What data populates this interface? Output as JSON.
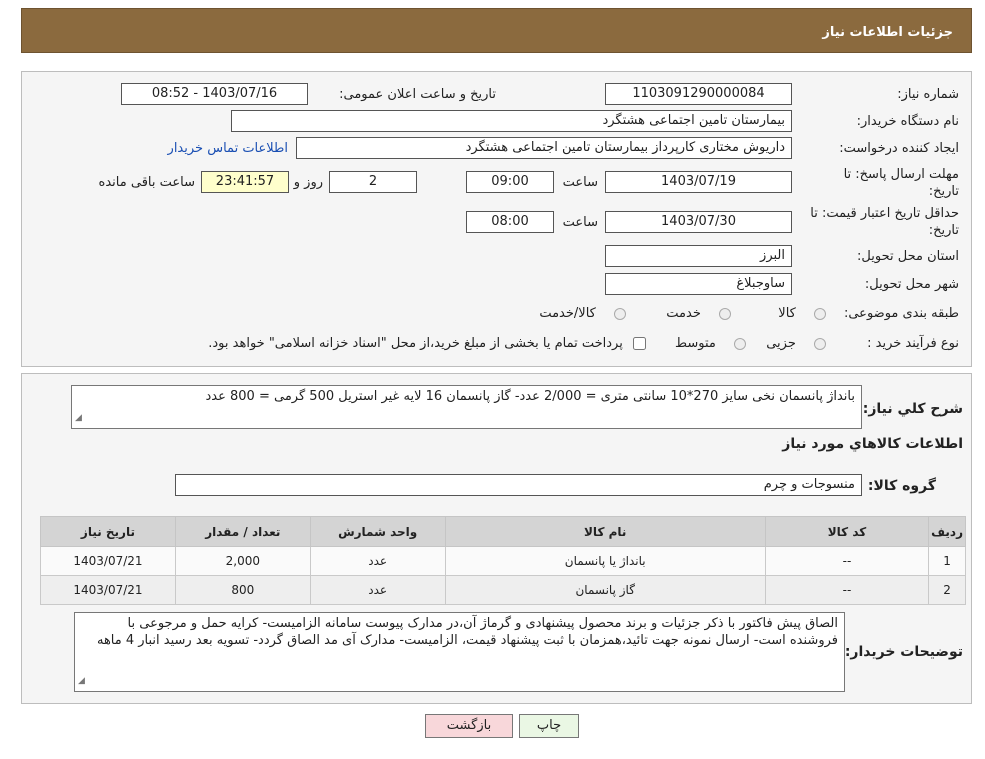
{
  "header": {
    "title": "جزئیات اطلاعات نیاز"
  },
  "form": {
    "need_number_label": "شماره نیاز:",
    "need_number": "1103091290000084",
    "announce_label": "تاریخ و ساعت اعلان عمومی:",
    "announce_value": "1403/07/16 - 08:52",
    "buyer_org_label": "نام دستگاه خریدار:",
    "buyer_org": "بیمارستان تامین اجتماعی هشتگرد",
    "creator_label": "ایجاد کننده درخواست:",
    "creator": "داریوش مختاری کارپرداز بیمارستان تامین اجتماعی هشتگرد",
    "contact_link": "اطلاعات تماس خریدار",
    "reply_deadline_label": "مهلت ارسال پاسخ: تا تاریخ:",
    "reply_date": "1403/07/19",
    "time_label": "ساعت",
    "reply_time": "09:00",
    "days": "2",
    "days_label": "روز و",
    "remaining": "23:41:57",
    "remaining_label": "ساعت باقی مانده",
    "price_validity_label": "حداقل تاریخ اعتبار قیمت: تا تاریخ:",
    "price_date": "1403/07/30",
    "price_time": "08:00",
    "province_label": "استان محل تحویل:",
    "province": "البرز",
    "city_label": "شهر محل تحویل:",
    "city": "ساوجبلاغ",
    "category_label": "طبقه بندی موضوعی:",
    "category_options": [
      "کالا",
      "خدمت",
      "کالا/خدمت"
    ],
    "process_label": "نوع فرآیند خرید :",
    "process_options": [
      "جزیی",
      "متوسط"
    ],
    "process_note": "پرداخت تمام یا بخشی از مبلغ خرید،از محل \"اسناد خزانه اسلامی\" خواهد بود."
  },
  "details": {
    "summary_label": "شرح کلي نياز:",
    "summary": "بانداژ پانسمان نخی سایز 270*10 سانتی متری = 2/000 عدد- گاز پانسمان 16 لایه غیر استریل 500 گرمی = 800 عدد",
    "goods_info_title": "اطلاعات کالاهاي مورد نياز",
    "goods_group_label": "گروه کالا:",
    "goods_group": "منسوجات و چرم",
    "table": {
      "headers": [
        "ردیف",
        "کد کالا",
        "نام کالا",
        "واحد شمارش",
        "تعداد / مقدار",
        "تاریخ نیاز"
      ],
      "rows": [
        [
          "1",
          "--",
          "بانداژ یا پانسمان",
          "عدد",
          "2,000",
          "1403/07/21"
        ],
        [
          "2",
          "--",
          "گاز پانسمان",
          "عدد",
          "800",
          "1403/07/21"
        ]
      ]
    },
    "buyer_notes_label": "توضیحات خریدار:",
    "buyer_notes": "الصاق پیش فاکتور با ذکر جزئیات و برند محصول پیشنهادی و گرماژ آن،در مدارک پیوست سامانه الزامیست- کرایه حمل و مرجوعی با فروشنده است- ارسال نمونه جهت تائید،همزمان با ثبت پیشنهاد قیمت، الزامیست- مدارک آی مد الصاق گردد- تسویه بعد رسید انبار 4 ماهه"
  },
  "buttons": {
    "print": "چاپ",
    "back": "بازگشت"
  },
  "colors": {
    "header": "#8b6a3e",
    "link": "#1a4fb3",
    "back_button": "#f8d7da",
    "print_button": "#eaf7e4"
  }
}
